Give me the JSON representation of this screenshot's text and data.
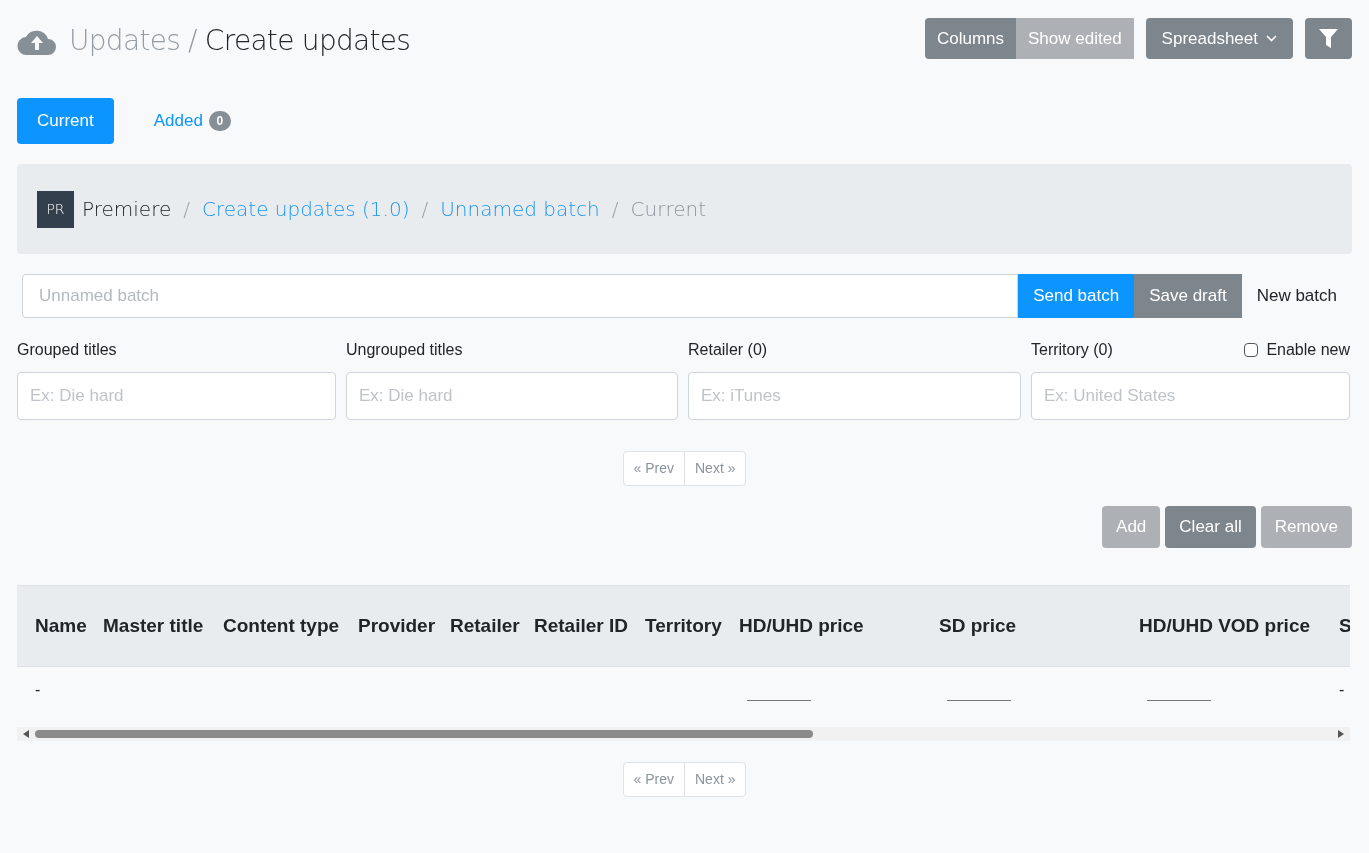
{
  "header": {
    "parent": "Updates",
    "separator": "/",
    "title": "Create updates"
  },
  "toolbar": {
    "group": [
      {
        "label": "Columns",
        "disabled": false
      },
      {
        "label": "Show edited",
        "disabled": true
      }
    ],
    "dropdown": "Spreadsheet"
  },
  "tabs": [
    {
      "label": "Current",
      "selected": true
    },
    {
      "label": "Added",
      "selected": false,
      "badge": "0"
    }
  ],
  "breadcrumb": {
    "avatar": "PR",
    "separator": "/",
    "items": [
      {
        "label": "Premiere",
        "kind": "text"
      },
      {
        "label": "Create updates (1.0)",
        "kind": "link"
      },
      {
        "label": "Unnamed batch",
        "kind": "link"
      },
      {
        "label": "Current",
        "kind": "muted"
      }
    ]
  },
  "batch": {
    "placeholder": "Unnamed batch",
    "actions": [
      {
        "label": "Send batch",
        "kind": "primary"
      },
      {
        "label": "Save draft",
        "kind": "secondary"
      },
      {
        "label": "New batch",
        "kind": "plain"
      }
    ]
  },
  "filters": [
    {
      "label": "Grouped titles",
      "placeholder": "Ex: Die hard"
    },
    {
      "label": "Ungrouped titles",
      "placeholder": "Ex: Die hard"
    },
    {
      "label": "Retailer (0)",
      "placeholder": "Ex: iTunes"
    },
    {
      "label": "Territory (0)",
      "placeholder": "Ex: United States"
    }
  ],
  "enable_new": {
    "label": "Enable new",
    "checked": false
  },
  "pager_top": {
    "prev": "« Prev",
    "next": "Next »"
  },
  "row_actions": [
    {
      "label": "Add",
      "disabled": true
    },
    {
      "label": "Clear all",
      "disabled": false
    },
    {
      "label": "Remove",
      "disabled": true
    }
  ],
  "table": {
    "columns": [
      "Name",
      "Master title",
      "Content type",
      "Provider",
      "Retailer",
      "Retailer ID",
      "Territory",
      "HD/UHD price",
      "SD price",
      "HD/UHD VOD price",
      "S"
    ],
    "rows": [
      [
        {
          "kind": "text",
          "value": "-"
        },
        {
          "kind": "empty"
        },
        {
          "kind": "empty"
        },
        {
          "kind": "empty"
        },
        {
          "kind": "empty"
        },
        {
          "kind": "empty"
        },
        {
          "kind": "empty"
        },
        {
          "kind": "field"
        },
        {
          "kind": "field"
        },
        {
          "kind": "field"
        },
        {
          "kind": "text",
          "value": "-"
        }
      ]
    ]
  },
  "pager_bottom": {
    "prev": "« Prev",
    "next": "Next »"
  }
}
